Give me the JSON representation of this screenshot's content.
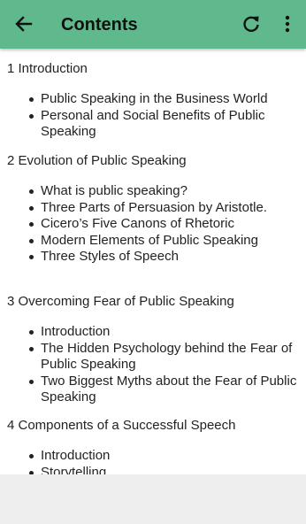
{
  "app_bar": {
    "title": "Contents",
    "back_icon": "arrow-left-icon",
    "refresh_icon": "refresh-icon",
    "menu_icon": "more-vertical-icon",
    "color": "#5fb98d"
  },
  "sections": [
    {
      "title": "1 Introduction",
      "items": [
        "Public Speaking in the Business World",
        "Personal and Social Benefits of Public Speaking"
      ]
    },
    {
      "title": "2 Evolution of Public Speaking",
      "items": [
        "What is public speaking?",
        "Three Parts of Persuasion by Aristotle.",
        "Cicero’s Five Canons of Rhetoric",
        "Modern Elements of Public Speaking",
        "Three Styles of Speech"
      ]
    },
    {
      "title": "3 Overcoming Fear of Public Speaking",
      "items": [
        "Introduction",
        "The Hidden Psychology behind the Fear of Public Speaking",
        "Two Biggest Myths about the Fear of Public Speaking"
      ]
    },
    {
      "title": "4 Components of a Successful Speech",
      "items": [
        "Introduction",
        "Storytelling"
      ]
    }
  ]
}
